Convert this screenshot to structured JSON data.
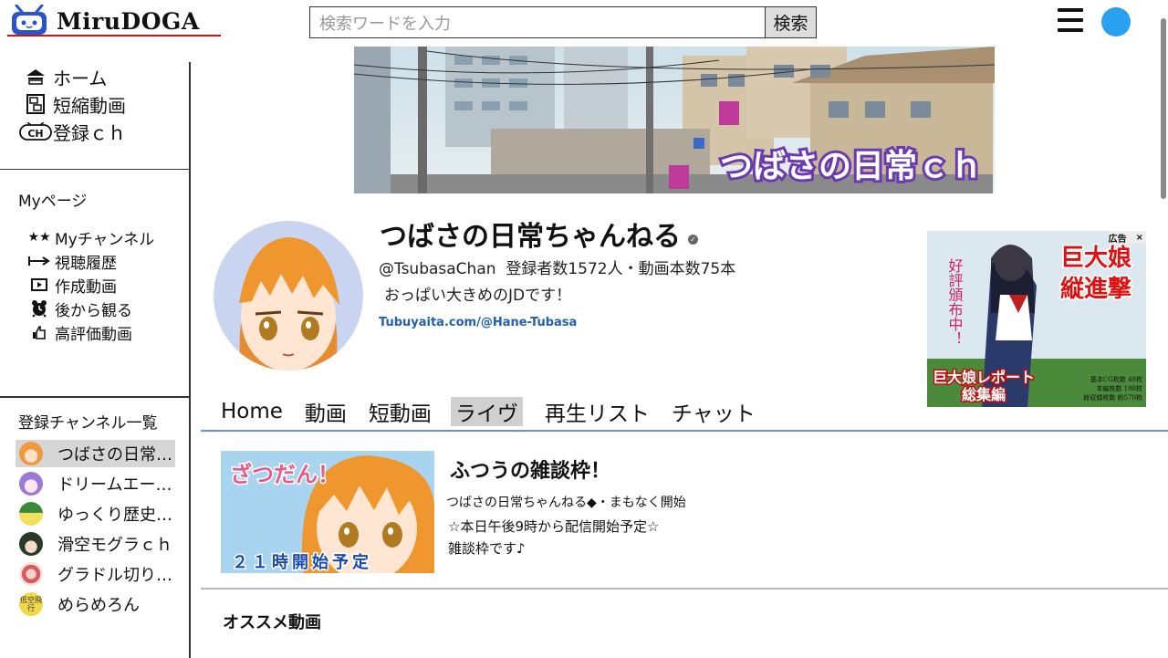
{
  "app": {
    "name": "MiruDOGA",
    "accent": "#d01010",
    "user_avatar_color": "#2aa0f0"
  },
  "search": {
    "placeholder": "検索ワードを入力",
    "button_label": "検索"
  },
  "sidebar": {
    "nav": [
      {
        "icon": "home-icon",
        "label": "ホーム"
      },
      {
        "icon": "shorts-icon",
        "label": "短縮動画"
      },
      {
        "icon": "channel-tv-icon",
        "label": "登録ｃｈ"
      }
    ],
    "mypage_title": "Myページ",
    "mypage": [
      {
        "icon": "stars-icon",
        "label": "Myチャンネル"
      },
      {
        "icon": "history-icon",
        "label": "視聴履歴"
      },
      {
        "icon": "video-play-icon",
        "label": "作成動画"
      },
      {
        "icon": "watch-later-icon",
        "label": "後から観る"
      },
      {
        "icon": "thumbs-up-icon",
        "label": "高評価動画"
      }
    ],
    "subs_title": "登録チャンネル一覧",
    "subs": [
      {
        "label": "つばさの日常…",
        "color": "#f09a40",
        "active": true
      },
      {
        "label": "ドリームエー…",
        "color": "#9a7ad8",
        "active": false
      },
      {
        "label": "ゆっくり歴史…",
        "color": "#3a8a3a",
        "active": false
      },
      {
        "label": "滑空モグラｃｈ",
        "color": "#2a3a2a",
        "active": false
      },
      {
        "label": "グラドル切り…",
        "color": "#d85a5a",
        "active": false
      },
      {
        "label": "めらめろん",
        "color": "#f0d84a",
        "active": false
      }
    ],
    "subs_last_icon_text": "低空飛行"
  },
  "banner": {
    "text": "つばさの日常ｃｈ"
  },
  "channel": {
    "name": "つばさの日常ちゃんねる",
    "handle": "@TsubasaChan",
    "stats": "登録者数1572人・動画本数75本",
    "description": "おっぱい大きめのJDです！",
    "link": "Tubuyaita.com/@Hane-Tubasa"
  },
  "ad": {
    "badge": "広告",
    "close": "×",
    "title_line1": "巨大娘",
    "title_line2": "縦進撃",
    "side_text": "好評頒布中！",
    "bottom_line1": "巨大娘レポート",
    "bottom_line2": "総集編",
    "specs": [
      "基本CG枚数 49枚",
      "本編枚数 198枚",
      "総収録枚数 約570枚"
    ]
  },
  "tabs": [
    {
      "label": "Home",
      "active": false
    },
    {
      "label": "動画",
      "active": false
    },
    {
      "label": "短動画",
      "active": false
    },
    {
      "label": "ライヴ",
      "active": true
    },
    {
      "label": "再生リスト",
      "active": false
    },
    {
      "label": "チャット",
      "active": false
    }
  ],
  "live": {
    "thumb_top_text": "ざつだん！",
    "thumb_bottom_text": "２１時開始予定",
    "title": "ふつうの雑談枠！",
    "channel_status": "つばさの日常ちゃんねる◆・まもなく開始",
    "desc_line1": "☆本日午後9時から配信開始予定☆",
    "desc_line2": "雑談枠です♪"
  },
  "section": {
    "recommended_title": "オススメ動画"
  }
}
